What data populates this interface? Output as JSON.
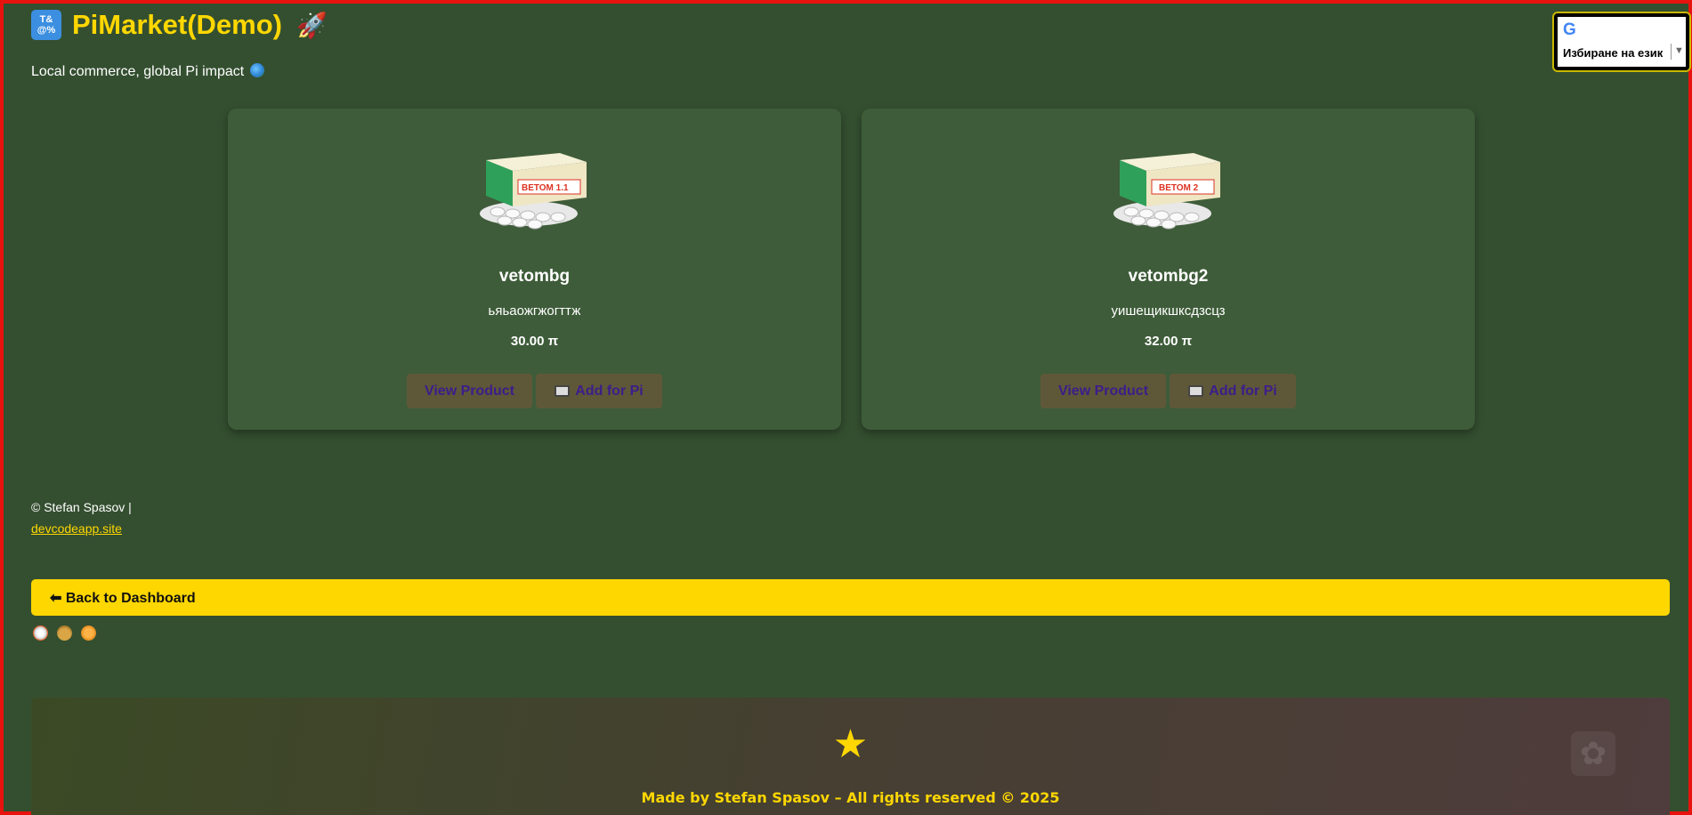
{
  "header": {
    "title": "PiMarket(Demo)",
    "symbol_icon": "input-symbols-icon",
    "rocket_icon": "rocket-icon",
    "tagline": "Local commerce, global Pi impact"
  },
  "language_widget": {
    "label": "Избиране на език",
    "logo": "google-g-icon"
  },
  "products": [
    {
      "name": "vetombg",
      "description": "ьяьаожгжогттж",
      "price": "30.00 π",
      "box_label": "ВЕТОМ 1.1"
    },
    {
      "name": "vetombg2",
      "description": "уишещикшксдзсцз",
      "price": "32.00 π",
      "box_label": "ВЕТОМ 2"
    }
  ],
  "buttons": {
    "view_product": "View Product",
    "add_for_pi": "Add for Pi"
  },
  "footer": {
    "credit": "© Stefan Spasov |",
    "link": "devcodeapp.site",
    "back_button": "⬅ Back to Dashboard",
    "made_by": "Made by Stefan Spasov – All rights reserved © 2025"
  },
  "colors": {
    "background": "#344f30",
    "card": "#3e5c39",
    "accent": "#ffd700",
    "button_bg": "#5e5838",
    "button_text": "#3d1d8a"
  }
}
